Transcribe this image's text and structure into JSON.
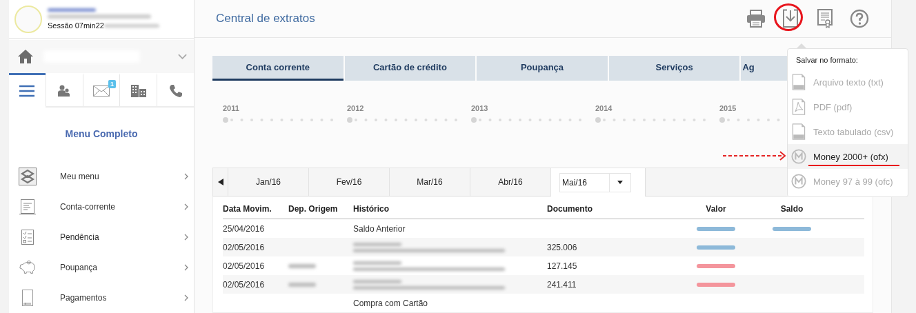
{
  "sidebar": {
    "session": "Sessão 07min22",
    "tabs": [
      {
        "kind": "menu",
        "selected": true
      },
      {
        "kind": "people",
        "selected": false
      },
      {
        "kind": "mail",
        "selected": false,
        "badge": "1"
      },
      {
        "kind": "building",
        "selected": false
      },
      {
        "kind": "phone",
        "selected": false
      }
    ],
    "menu_title": "Menu Completo",
    "menu_items": [
      {
        "kind": "logo",
        "label": "Meu menu"
      },
      {
        "kind": "statement",
        "label": "Conta-corrente"
      },
      {
        "kind": "checklist",
        "label": "Pendência"
      },
      {
        "kind": "piggy",
        "label": "Poupança"
      },
      {
        "kind": "barcode",
        "label": "Pagamentos"
      }
    ]
  },
  "header": {
    "title": "Central de extratos"
  },
  "tabs": [
    {
      "label": "Conta corrente",
      "selected": true
    },
    {
      "label": "Cartão de crédito",
      "selected": false
    },
    {
      "label": "Poupança",
      "selected": false
    },
    {
      "label": "Serviços",
      "selected": false
    },
    {
      "label": "Ag",
      "selected": false
    }
  ],
  "timeline": {
    "years": [
      "2011",
      "2012",
      "2013",
      "2014",
      "2015"
    ]
  },
  "months": {
    "items": [
      {
        "label": "Jan/16"
      },
      {
        "label": "Fev/16"
      },
      {
        "label": "Mar/16"
      },
      {
        "label": "Abr/16"
      }
    ],
    "current": "Mai/16"
  },
  "table": {
    "columns": [
      "Data Movim.",
      "Dep. Origem",
      "Histórico",
      "Documento",
      "Valor",
      "Saldo"
    ],
    "rows": [
      {
        "date": "25/04/2016",
        "historico": "Saldo Anterior",
        "color": "#8db9d9",
        "saldo_redacted": true
      },
      {
        "date": "02/05/2016",
        "historico_redacted": true,
        "documento": "325.006",
        "color": "#8db9d9"
      },
      {
        "date": "02/05/2016",
        "dep_origem_redacted": true,
        "historico_redacted": true,
        "documento": "127.145",
        "color": "#f4959c"
      },
      {
        "date": "02/05/2016",
        "dep_origem_redacted": true,
        "historico_redacted": true,
        "documento": "241.411",
        "color": "#f4959c"
      },
      {
        "historico": "Compra com Cartão"
      }
    ]
  },
  "save_menu": {
    "title": "Salvar no formato:",
    "items": [
      {
        "kind": "txt",
        "label": "Arquivo texto (txt)",
        "selected": false
      },
      {
        "kind": "pdf",
        "label": "PDF (pdf)",
        "selected": false
      },
      {
        "kind": "csv",
        "label": "Texto tabulado (csv)",
        "selected": false
      },
      {
        "kind": "money",
        "label": "Money 2000+ (ofx)",
        "selected": true
      },
      {
        "kind": "money",
        "label": "Money 97 à 99 (ofc)",
        "selected": false
      }
    ]
  }
}
